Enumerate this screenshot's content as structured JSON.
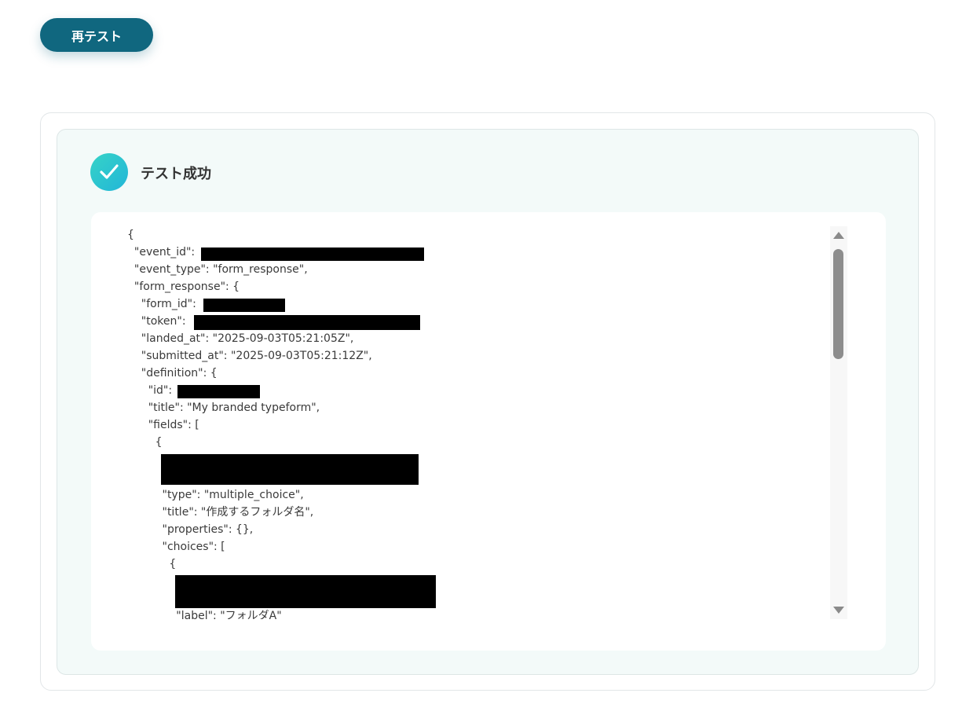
{
  "toolbar": {
    "retest_label": "再テスト"
  },
  "result": {
    "status_title": "テスト成功",
    "icon": "check-circle-icon",
    "accent_color": "#10677f"
  },
  "code": {
    "lines": [
      "{",
      "  \"event_id\":",
      "  \"event_type\": \"form_response\",",
      "  \"form_response\": {",
      "    \"form_id\":",
      "    \"token\":",
      "    \"landed_at\": \"2025-09-03T05:21:05Z\",",
      "    \"submitted_at\": \"2025-09-03T05:21:12Z\",",
      "    \"definition\": {",
      "      \"id\":",
      "      \"title\": \"My branded typeform\",",
      "      \"fields\": [",
      "        {",
      "",
      "          \"type\": \"multiple_choice\",",
      "          \"title\": \"作成するフォルダ名\",",
      "          \"properties\": {},",
      "          \"choices\": [",
      "            {",
      "",
      "              \"label\": \"フォルダA\""
    ]
  }
}
